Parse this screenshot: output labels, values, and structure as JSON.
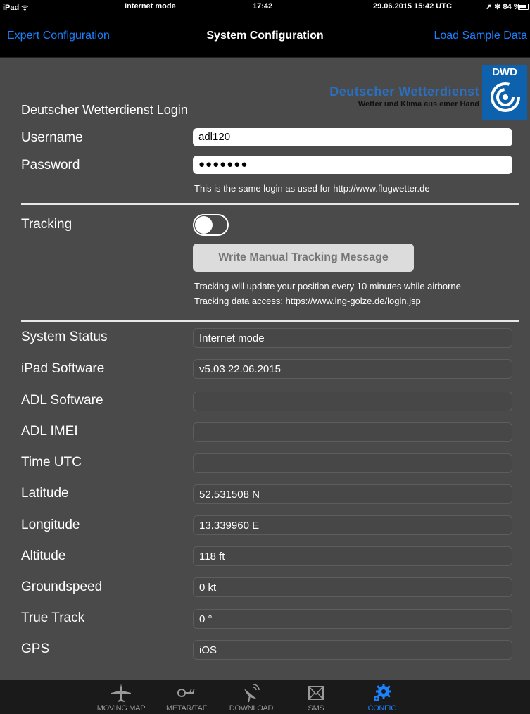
{
  "status_bar": {
    "device": "iPad ᯤ",
    "mode": "Internet mode",
    "time": "17:42",
    "date": "29.06.2015 15:42 UTC",
    "right": "➚ ✻ 84 %"
  },
  "nav": {
    "left": "Expert Configuration",
    "title": "System Configuration",
    "right": "Load Sample Data"
  },
  "dwd": {
    "abbr": "DWD",
    "name": "Deutscher Wetterdienst",
    "slogan": "Wetter und Klima aus einer Hand"
  },
  "login": {
    "title": "Deutscher Wetterdienst Login",
    "username_label": "Username",
    "username_value": "adl120",
    "password_label": "Password",
    "password_value": "●●●●●●●",
    "hint": "This is the same login as used for http://www.flugwetter.de"
  },
  "tracking": {
    "label": "Tracking",
    "enabled": false,
    "button": "Write Manual Tracking Message",
    "hint1": "Tracking will update your position every 10 minutes while airborne",
    "hint2": "Tracking data access: https://www.ing-golze.de/login.jsp"
  },
  "status": [
    {
      "label": "System Status",
      "value": "Internet mode"
    },
    {
      "label": "iPad Software",
      "value": "v5.03 22.06.2015"
    },
    {
      "label": "ADL Software",
      "value": ""
    },
    {
      "label": "ADL IMEI",
      "value": ""
    },
    {
      "label": "Time UTC",
      "value": ""
    },
    {
      "label": "Latitude",
      "value": "52.531508 N"
    },
    {
      "label": "Longitude",
      "value": "13.339960 E"
    },
    {
      "label": "Altitude",
      "value": "118 ft"
    },
    {
      "label": "Groundspeed",
      "value": "0 kt"
    },
    {
      "label": "True Track",
      "value": "0 °"
    },
    {
      "label": "GPS",
      "value": "iOS"
    }
  ],
  "tabs": [
    {
      "label": "MOVING MAP",
      "icon": "plane-icon"
    },
    {
      "label": "METAR/TAF",
      "icon": "windsock-icon"
    },
    {
      "label": "DOWNLOAD",
      "icon": "satellite-dish-icon"
    },
    {
      "label": "SMS",
      "icon": "envelope-icon"
    },
    {
      "label": "CONFIG",
      "icon": "gear-icon",
      "active": true
    }
  ],
  "colors": {
    "accent": "#1a82ff",
    "background": "#4a4a4a",
    "dwd_blue": "#0e61ad"
  }
}
